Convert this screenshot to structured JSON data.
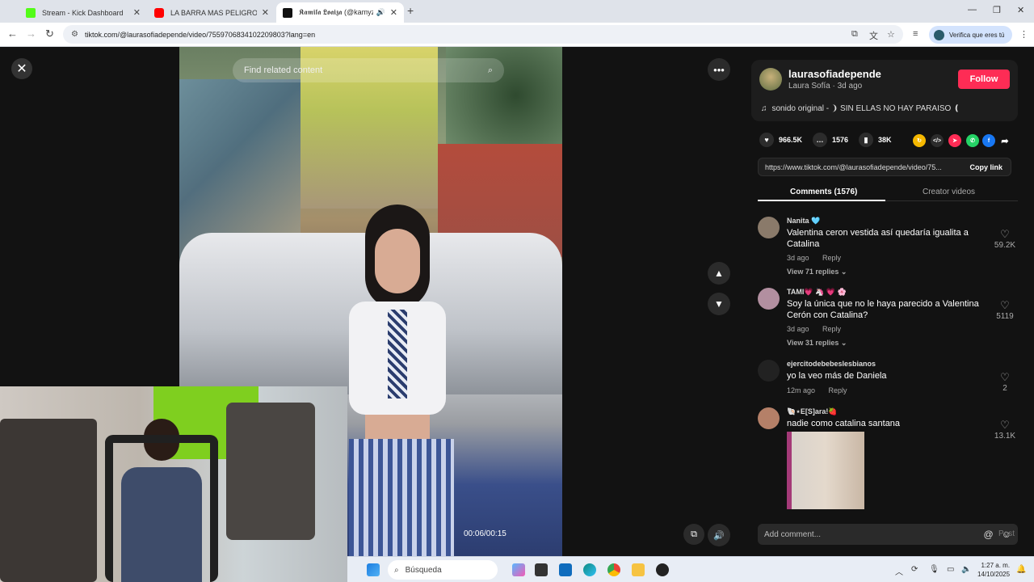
{
  "browser": {
    "tabs": [
      {
        "title": "Stream - Kick Dashboard",
        "favicon_color": "#53fc18",
        "active": false
      },
      {
        "title": "LA BARRA MAS PELIGROSA DE",
        "favicon_color": "#ff0000",
        "active": false
      },
      {
        "title": "𝕶𝖆𝖒𝖎𝖑𝖆 𝕷𝖔𝖆𝖎𝖟𝖆 (@kamyzs",
        "favicon_color": "#111111",
        "active": true
      }
    ],
    "url": "tiktok.com/@laurasofiadepende/video/7559706834102209803?lang=en",
    "profile_label": "Verifica que eres tú"
  },
  "player": {
    "search_placeholder": "Find related content",
    "timecode": "00:06/00:15"
  },
  "post": {
    "username": "laurasofiadepende",
    "display_name": "Laura Sofía",
    "age": "3d ago",
    "follow_label": "Follow",
    "music": "sonido original - ❩ SIN ELLAS NO HAY PARAISO ❪",
    "likes": "966.5K",
    "comments_count": "1576",
    "saves": "38K",
    "link": "https://www.tiktok.com/@laurasofiadepende/video/75...",
    "copy_label": "Copy link"
  },
  "panel_tabs": {
    "comments": "Comments (1576)",
    "creator": "Creator videos"
  },
  "comments": [
    {
      "name": "Nanita 🩵",
      "text": "Valentina ceron vestida así quedaría igualita a Catalina",
      "time": "3d ago",
      "reply": "Reply",
      "replies": "View 71 replies ⌄",
      "likes": "59.2K",
      "avatar_color": "#8a7a6a"
    },
    {
      "name": "TAMI💗 🦄 💗 🌸",
      "text": "Soy la única que no le haya parecido a Valentina Cerón con Catalina?",
      "time": "3d ago",
      "reply": "Reply",
      "replies": "View 31 replies ⌄",
      "likes": "5119",
      "avatar_color": "#b28fa0"
    },
    {
      "name": "ejercitodebebeslesbianos",
      "text": "yo la veo más de Daniela",
      "time": "12m ago",
      "reply": "Reply",
      "replies": "",
      "likes": "2",
      "avatar_color": "#222222"
    },
    {
      "name": "🐚⋆E[S]ara!🍓",
      "text": "nadie como catalina santana",
      "time": "",
      "reply": "",
      "replies": "",
      "likes": "13.1K",
      "avatar_color": "#b58068"
    }
  ],
  "add_comment": {
    "placeholder": "Add comment...",
    "post_label": "Post"
  },
  "taskbar": {
    "search_label": "Búsqueda",
    "time": "1:27 a. m.",
    "date": "14/10/2025"
  },
  "icons": {
    "close": "close-icon",
    "more": "more-icon",
    "up": "chevron-up-icon",
    "down": "chevron-down-icon",
    "volume": "volume-icon",
    "pip": "pip-icon",
    "heart": "heart-icon",
    "comment": "comment-icon",
    "bookmark": "bookmark-icon"
  }
}
